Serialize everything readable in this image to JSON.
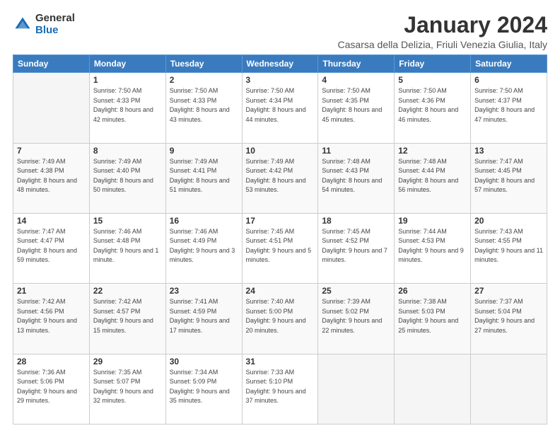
{
  "logo": {
    "general": "General",
    "blue": "Blue"
  },
  "header": {
    "title": "January 2024",
    "subtitle": "Casarsa della Delizia, Friuli Venezia Giulia, Italy"
  },
  "days_of_week": [
    "Sunday",
    "Monday",
    "Tuesday",
    "Wednesday",
    "Thursday",
    "Friday",
    "Saturday"
  ],
  "weeks": [
    [
      {
        "day": "",
        "empty": true
      },
      {
        "day": "1",
        "sunrise": "Sunrise: 7:50 AM",
        "sunset": "Sunset: 4:33 PM",
        "daylight": "Daylight: 8 hours and 42 minutes."
      },
      {
        "day": "2",
        "sunrise": "Sunrise: 7:50 AM",
        "sunset": "Sunset: 4:33 PM",
        "daylight": "Daylight: 8 hours and 43 minutes."
      },
      {
        "day": "3",
        "sunrise": "Sunrise: 7:50 AM",
        "sunset": "Sunset: 4:34 PM",
        "daylight": "Daylight: 8 hours and 44 minutes."
      },
      {
        "day": "4",
        "sunrise": "Sunrise: 7:50 AM",
        "sunset": "Sunset: 4:35 PM",
        "daylight": "Daylight: 8 hours and 45 minutes."
      },
      {
        "day": "5",
        "sunrise": "Sunrise: 7:50 AM",
        "sunset": "Sunset: 4:36 PM",
        "daylight": "Daylight: 8 hours and 46 minutes."
      },
      {
        "day": "6",
        "sunrise": "Sunrise: 7:50 AM",
        "sunset": "Sunset: 4:37 PM",
        "daylight": "Daylight: 8 hours and 47 minutes."
      }
    ],
    [
      {
        "day": "7",
        "sunrise": "Sunrise: 7:49 AM",
        "sunset": "Sunset: 4:38 PM",
        "daylight": "Daylight: 8 hours and 48 minutes."
      },
      {
        "day": "8",
        "sunrise": "Sunrise: 7:49 AM",
        "sunset": "Sunset: 4:40 PM",
        "daylight": "Daylight: 8 hours and 50 minutes."
      },
      {
        "day": "9",
        "sunrise": "Sunrise: 7:49 AM",
        "sunset": "Sunset: 4:41 PM",
        "daylight": "Daylight: 8 hours and 51 minutes."
      },
      {
        "day": "10",
        "sunrise": "Sunrise: 7:49 AM",
        "sunset": "Sunset: 4:42 PM",
        "daylight": "Daylight: 8 hours and 53 minutes."
      },
      {
        "day": "11",
        "sunrise": "Sunrise: 7:48 AM",
        "sunset": "Sunset: 4:43 PM",
        "daylight": "Daylight: 8 hours and 54 minutes."
      },
      {
        "day": "12",
        "sunrise": "Sunrise: 7:48 AM",
        "sunset": "Sunset: 4:44 PM",
        "daylight": "Daylight: 8 hours and 56 minutes."
      },
      {
        "day": "13",
        "sunrise": "Sunrise: 7:47 AM",
        "sunset": "Sunset: 4:45 PM",
        "daylight": "Daylight: 8 hours and 57 minutes."
      }
    ],
    [
      {
        "day": "14",
        "sunrise": "Sunrise: 7:47 AM",
        "sunset": "Sunset: 4:47 PM",
        "daylight": "Daylight: 8 hours and 59 minutes."
      },
      {
        "day": "15",
        "sunrise": "Sunrise: 7:46 AM",
        "sunset": "Sunset: 4:48 PM",
        "daylight": "Daylight: 9 hours and 1 minute."
      },
      {
        "day": "16",
        "sunrise": "Sunrise: 7:46 AM",
        "sunset": "Sunset: 4:49 PM",
        "daylight": "Daylight: 9 hours and 3 minutes."
      },
      {
        "day": "17",
        "sunrise": "Sunrise: 7:45 AM",
        "sunset": "Sunset: 4:51 PM",
        "daylight": "Daylight: 9 hours and 5 minutes."
      },
      {
        "day": "18",
        "sunrise": "Sunrise: 7:45 AM",
        "sunset": "Sunset: 4:52 PM",
        "daylight": "Daylight: 9 hours and 7 minutes."
      },
      {
        "day": "19",
        "sunrise": "Sunrise: 7:44 AM",
        "sunset": "Sunset: 4:53 PM",
        "daylight": "Daylight: 9 hours and 9 minutes."
      },
      {
        "day": "20",
        "sunrise": "Sunrise: 7:43 AM",
        "sunset": "Sunset: 4:55 PM",
        "daylight": "Daylight: 9 hours and 11 minutes."
      }
    ],
    [
      {
        "day": "21",
        "sunrise": "Sunrise: 7:42 AM",
        "sunset": "Sunset: 4:56 PM",
        "daylight": "Daylight: 9 hours and 13 minutes."
      },
      {
        "day": "22",
        "sunrise": "Sunrise: 7:42 AM",
        "sunset": "Sunset: 4:57 PM",
        "daylight": "Daylight: 9 hours and 15 minutes."
      },
      {
        "day": "23",
        "sunrise": "Sunrise: 7:41 AM",
        "sunset": "Sunset: 4:59 PM",
        "daylight": "Daylight: 9 hours and 17 minutes."
      },
      {
        "day": "24",
        "sunrise": "Sunrise: 7:40 AM",
        "sunset": "Sunset: 5:00 PM",
        "daylight": "Daylight: 9 hours and 20 minutes."
      },
      {
        "day": "25",
        "sunrise": "Sunrise: 7:39 AM",
        "sunset": "Sunset: 5:02 PM",
        "daylight": "Daylight: 9 hours and 22 minutes."
      },
      {
        "day": "26",
        "sunrise": "Sunrise: 7:38 AM",
        "sunset": "Sunset: 5:03 PM",
        "daylight": "Daylight: 9 hours and 25 minutes."
      },
      {
        "day": "27",
        "sunrise": "Sunrise: 7:37 AM",
        "sunset": "Sunset: 5:04 PM",
        "daylight": "Daylight: 9 hours and 27 minutes."
      }
    ],
    [
      {
        "day": "28",
        "sunrise": "Sunrise: 7:36 AM",
        "sunset": "Sunset: 5:06 PM",
        "daylight": "Daylight: 9 hours and 29 minutes."
      },
      {
        "day": "29",
        "sunrise": "Sunrise: 7:35 AM",
        "sunset": "Sunset: 5:07 PM",
        "daylight": "Daylight: 9 hours and 32 minutes."
      },
      {
        "day": "30",
        "sunrise": "Sunrise: 7:34 AM",
        "sunset": "Sunset: 5:09 PM",
        "daylight": "Daylight: 9 hours and 35 minutes."
      },
      {
        "day": "31",
        "sunrise": "Sunrise: 7:33 AM",
        "sunset": "Sunset: 5:10 PM",
        "daylight": "Daylight: 9 hours and 37 minutes."
      },
      {
        "day": "",
        "empty": true
      },
      {
        "day": "",
        "empty": true
      },
      {
        "day": "",
        "empty": true
      }
    ]
  ]
}
